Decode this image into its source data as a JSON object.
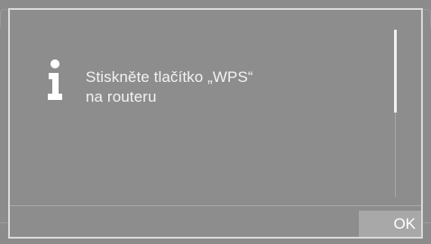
{
  "dialog": {
    "icon": "info-icon",
    "message_lines": [
      "Stiskněte tlačítko „WPS“",
      "na routeru"
    ],
    "ok_label": "OK"
  },
  "colors": {
    "background": "#8c8c8c",
    "dialog_border": "#d9d9d9",
    "text": "#f2f2f2",
    "button": "#a8a8a8"
  }
}
